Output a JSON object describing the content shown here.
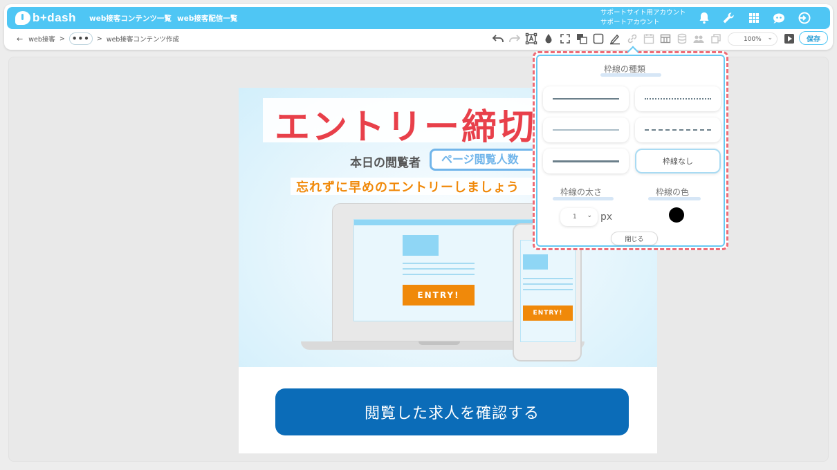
{
  "app": {
    "logo_text": "b+dash"
  },
  "header": {
    "nav": [
      "web接客コンテンツ一覧",
      "web接客配信一覧"
    ],
    "account_line1": "サポートサイト用アカウント",
    "account_line2": "サポートアカウント",
    "icons": [
      "bell-icon",
      "wrench-icon",
      "grid-icon",
      "chat-bot-icon",
      "logout-icon"
    ]
  },
  "breadcrumb": {
    "back": "←",
    "root": "web接客",
    "sep": ">",
    "dots": "•••",
    "current": "web接客コンテンツ作成"
  },
  "toolbar": {
    "icons": [
      "undo-icon",
      "redo-icon",
      "text-box-icon",
      "fill-drop-icon",
      "fullscreen-icon",
      "layer-icon",
      "border-icon",
      "pen-icon",
      "link-icon",
      "calendar-icon",
      "table-icon",
      "database-icon",
      "users-icon",
      "copy-icon"
    ],
    "zoom": "100%",
    "save_label": "保存"
  },
  "content": {
    "title": "エントリー締切",
    "viewers_label": "本日の閲覧者",
    "viewers_box": "ページ閲覧人数",
    "reminder": "忘れずに早めのエントリーしましょう",
    "entry_label": "ENTRY!",
    "cta": "閲覧した求人を確認する"
  },
  "border_popup": {
    "type_title": "枠線の種類",
    "none_label": "枠線なし",
    "width_title": "枠線の太さ",
    "width_value": "1",
    "width_unit": "px",
    "color_title": "枠線の色",
    "color_value": "#000000",
    "close_label": "閉じる"
  },
  "colors": {
    "header": "#4fc6f4",
    "accent": "#2b9fd6",
    "title_red": "#e8404a",
    "orange": "#f0890a",
    "cta_blue": "#0b6cb8",
    "highlight_dash": "#ee6c77"
  }
}
